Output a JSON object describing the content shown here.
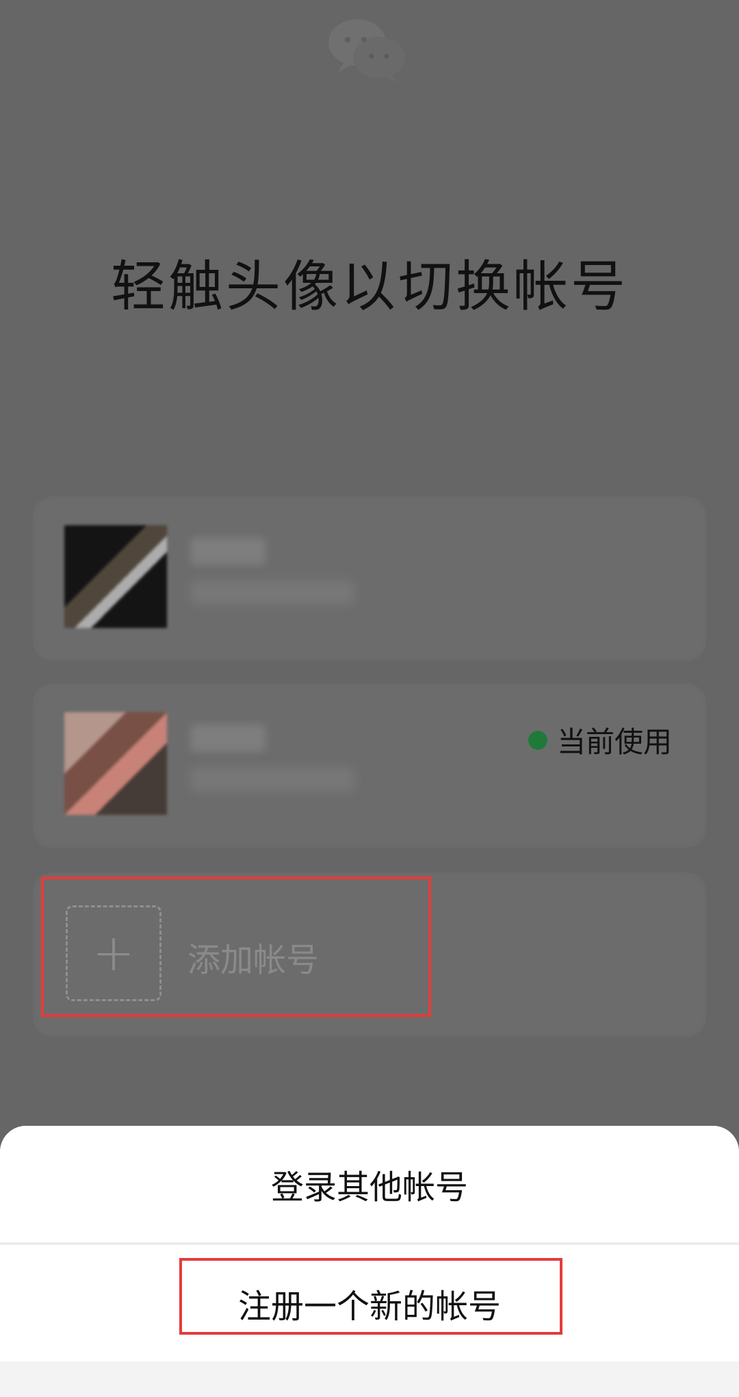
{
  "screen": {
    "title": "轻触头像以切换帐号"
  },
  "accounts": [
    {
      "status": ""
    },
    {
      "status": "当前使用"
    }
  ],
  "add_account": {
    "label": "添加帐号"
  },
  "bottom_sheet": {
    "options": [
      "登录其他帐号",
      "注册一个新的帐号"
    ]
  },
  "colors": {
    "background": "#666666",
    "card": "#6c6c6c",
    "sheet": "#ffffff",
    "highlight": "#e53b3b",
    "status_dot": "#1f7a3a"
  },
  "icons": {
    "logo": "wechat-logo-icon",
    "add": "plus-icon"
  }
}
